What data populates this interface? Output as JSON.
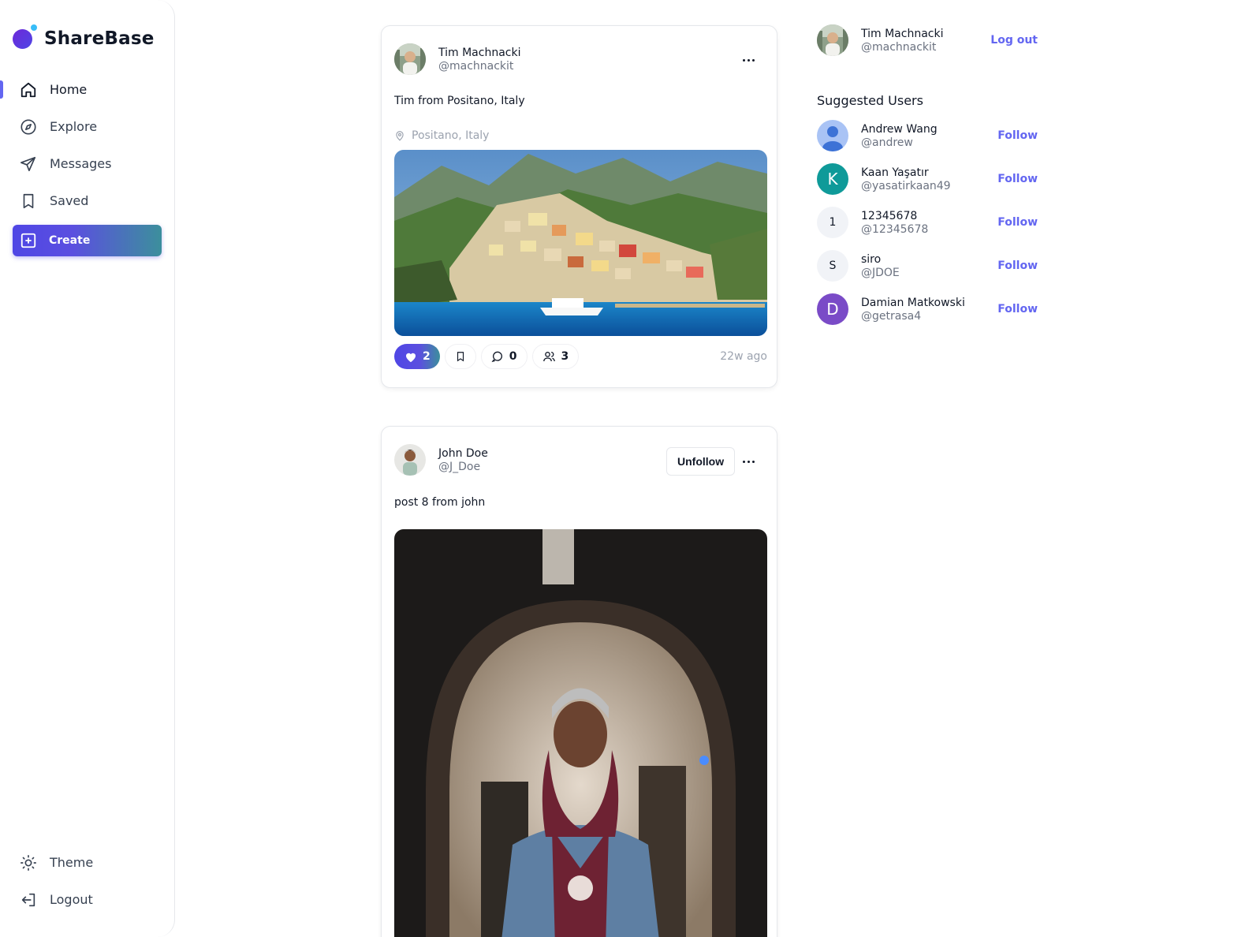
{
  "app": {
    "name": "ShareBase"
  },
  "nav": {
    "home": "Home",
    "explore": "Explore",
    "messages": "Messages",
    "saved": "Saved",
    "create": "Create",
    "theme": "Theme",
    "logout": "Logout"
  },
  "posts": [
    {
      "author_name": "Tim Machnacki",
      "author_handle": "@machnackit",
      "text": "Tim from Positano, Italy",
      "location": "Positano, Italy",
      "likes": "2",
      "comments": "0",
      "people": "3",
      "time": "22w ago"
    },
    {
      "author_name": "John Doe",
      "author_handle": "@J_Doe",
      "follow_button": "Unfollow",
      "text": "post 8 from john"
    }
  ],
  "current_user": {
    "name": "Tim Machnacki",
    "handle": "@machnackit",
    "logout": "Log out"
  },
  "suggested": {
    "title": "Suggested Users",
    "follow_label": "Follow",
    "users": [
      {
        "name": "Andrew Wang",
        "handle": "@andrew",
        "initial": "",
        "avatar_color": "#9ab8f5"
      },
      {
        "name": "Kaan Yaşatır",
        "handle": "@yasatirkaan49",
        "initial": "K",
        "avatar_color": "#0f9a99"
      },
      {
        "name": "12345678",
        "handle": "@12345678",
        "initial": "1",
        "avatar_color": "#f1f3f7"
      },
      {
        "name": "siro",
        "handle": "@JDOE",
        "initial": "S",
        "avatar_color": "#f1f3f7"
      },
      {
        "name": "Damian Matkowski",
        "handle": "@getrasa4",
        "initial": "D",
        "avatar_color": "#7a4bc7"
      }
    ]
  },
  "colors": {
    "accent": "#6366f1",
    "gradient_end": "#3c8f9c"
  }
}
